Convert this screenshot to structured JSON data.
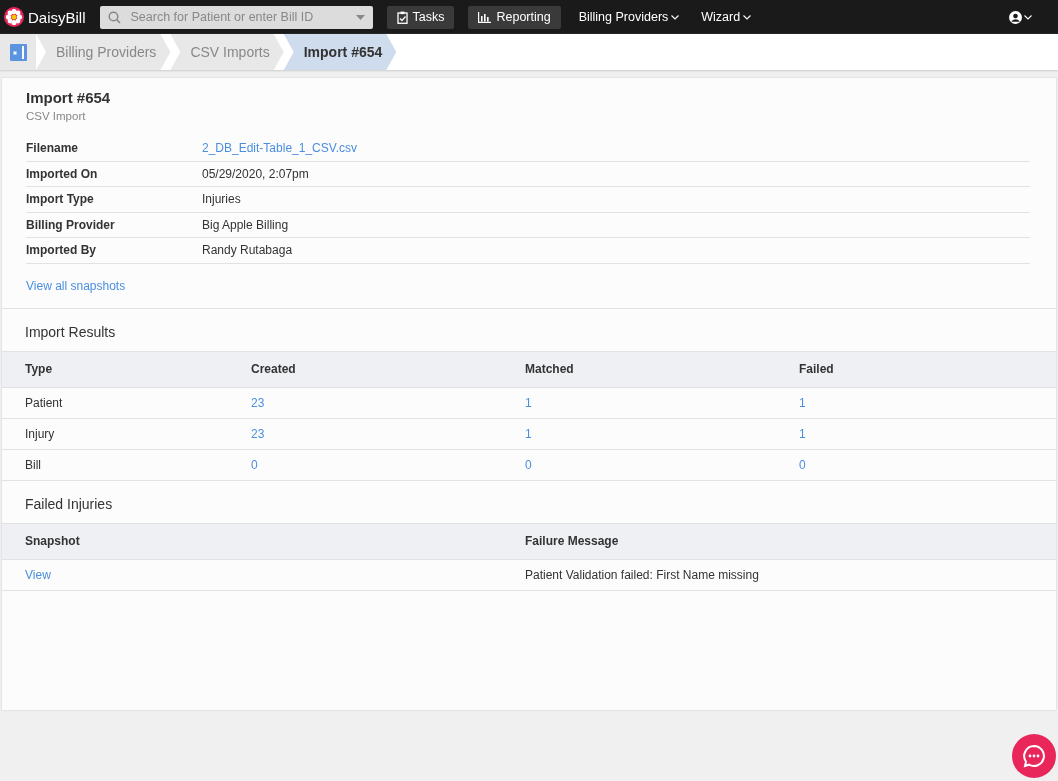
{
  "topbar": {
    "logo": "DaisyBill",
    "search": {
      "placeholder": "Search for Patient or enter Bill ID"
    },
    "nav": [
      {
        "kind": "button",
        "label": "Tasks"
      },
      {
        "kind": "button",
        "label": "Reporting"
      },
      {
        "kind": "dropdown",
        "label": "Billing Providers"
      },
      {
        "kind": "dropdown",
        "label": "Wizard"
      }
    ]
  },
  "breadcrumbs": [
    {
      "label": "Billing Providers",
      "selected": false
    },
    {
      "label": "CSV Imports",
      "selected": false
    },
    {
      "label": "Import #654",
      "selected": true
    }
  ],
  "import": {
    "title": "Import #654",
    "subtitle": "CSV Import",
    "details": [
      {
        "label": "Filename",
        "value": "2_DB_Edit-Table_1_CSV.csv",
        "kind": "link"
      },
      {
        "label": "Imported On",
        "value": "05/29/2020, 2:07pm",
        "kind": "text"
      },
      {
        "label": "Import Type",
        "value": "Injuries",
        "kind": "text"
      },
      {
        "label": "Billing Provider",
        "value": "Big Apple Billing",
        "kind": "text"
      },
      {
        "label": "Imported By",
        "value": "Randy Rutabaga",
        "kind": "text"
      }
    ],
    "snapshots_link": "View all snapshots"
  },
  "results": {
    "title": "Import Results",
    "columns": [
      "Type",
      "Created",
      "Matched",
      "Failed"
    ],
    "rows": [
      [
        "Patient",
        "23",
        "1",
        "1"
      ],
      [
        "Injury",
        "23",
        "1",
        "1"
      ],
      [
        "Bill",
        "0",
        "0",
        "0"
      ]
    ]
  },
  "failed": {
    "title": "Failed Injuries",
    "columns": [
      "Snapshot",
      "Failure Message"
    ],
    "rows": [
      [
        "View",
        "Patient Validation failed: First Name missing"
      ]
    ]
  }
}
